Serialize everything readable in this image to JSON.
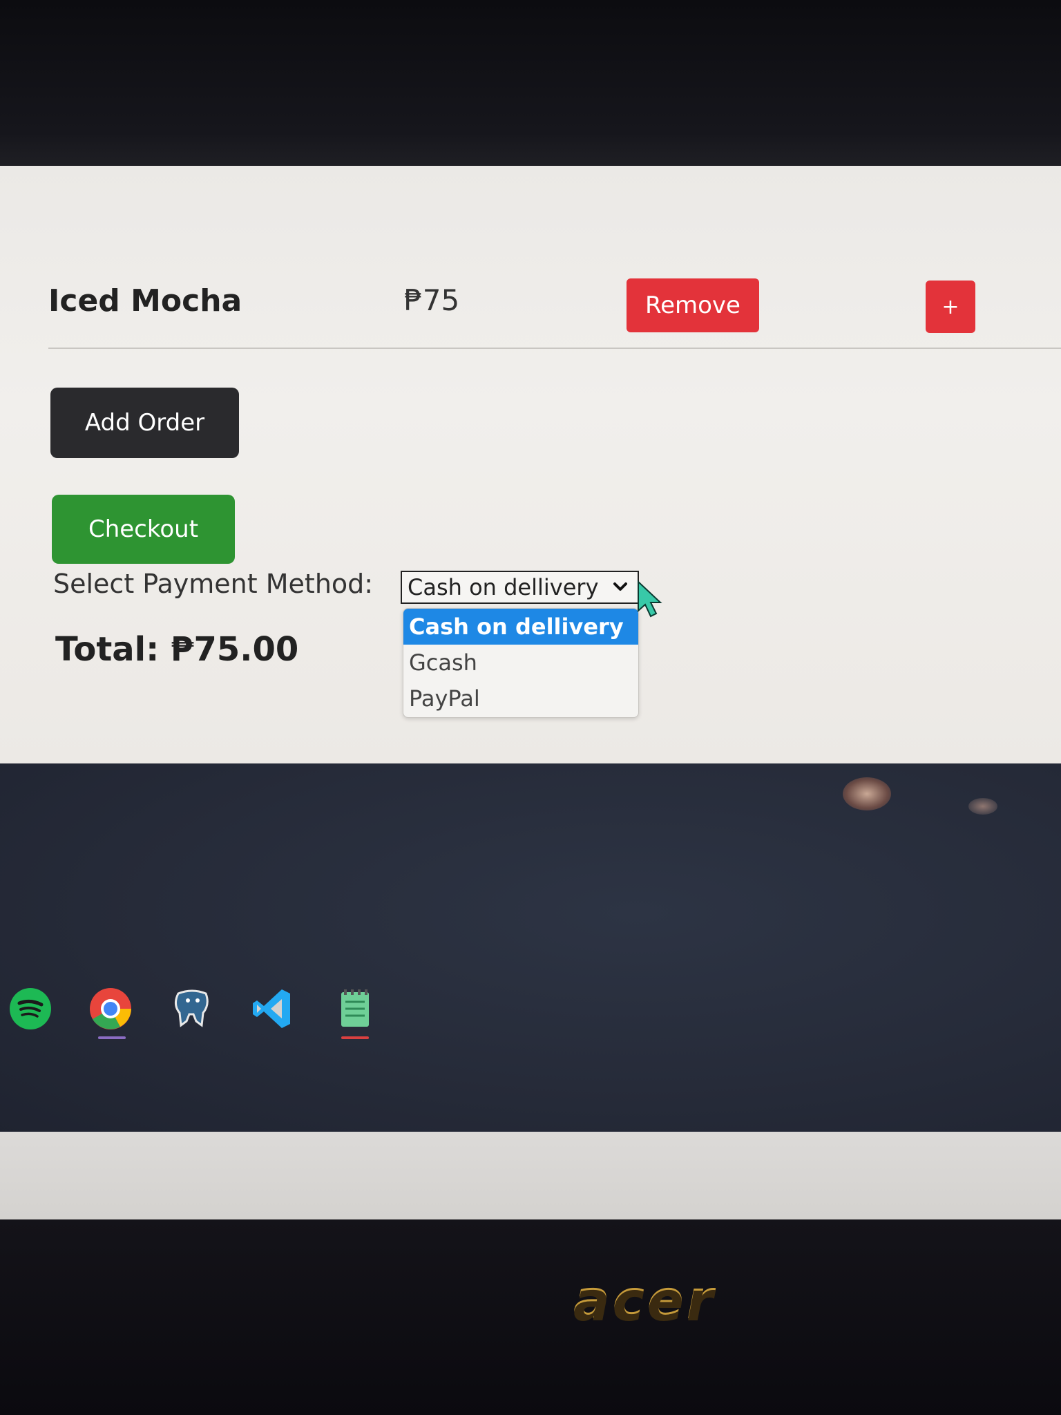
{
  "cart": {
    "item": {
      "name": "Iced Mocha",
      "price": "₱75",
      "remove_label": "Remove",
      "add_label": "+"
    },
    "add_order_label": "Add Order",
    "checkout_label": "Checkout"
  },
  "payment": {
    "label": "Select Payment Method:",
    "selected": "Cash on dellivery",
    "options": [
      "Cash on dellivery",
      "Gcash",
      "PayPal"
    ]
  },
  "total": {
    "label": "Total: ₱75.00"
  },
  "taskbar": {
    "apps": [
      "spotify-icon",
      "chrome-icon",
      "postgresql-icon",
      "vscode-icon",
      "notepad-icon"
    ]
  },
  "brand": {
    "logo": "acer"
  },
  "colors": {
    "danger": "#e3333a",
    "dark_button": "#2a2a2d",
    "success": "#2e9432",
    "highlight": "#1e88e5"
  }
}
